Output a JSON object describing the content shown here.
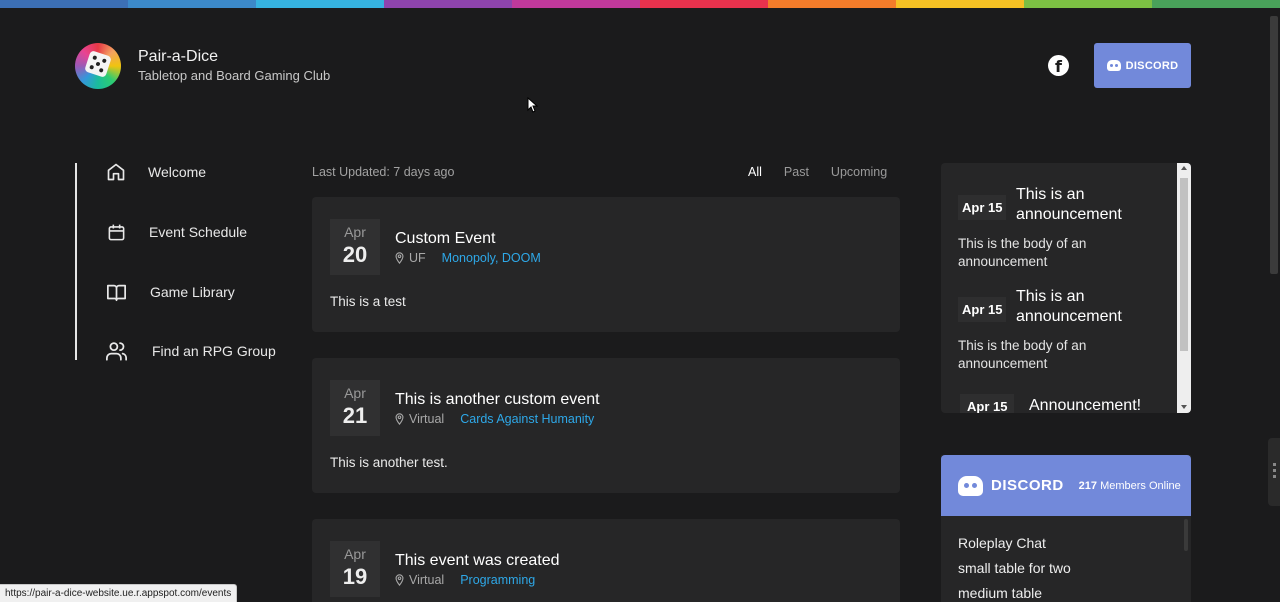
{
  "rainbow_colors": [
    "#3c6fb5",
    "#3c89c9",
    "#36b3e0",
    "#8e44ad",
    "#c0399b",
    "#e8324d",
    "#f47c2a",
    "#f6c124",
    "#7cc043",
    "#49a25a"
  ],
  "brand": {
    "title": "Pair-a-Dice",
    "subtitle": "Tabletop and Board Gaming Club"
  },
  "header": {
    "facebook_icon": "facebook-icon",
    "discord_label": "DISCORD"
  },
  "nav": [
    {
      "label": "Welcome",
      "icon": "home-icon"
    },
    {
      "label": "Event Schedule",
      "icon": "calendar-icon"
    },
    {
      "label": "Game Library",
      "icon": "book-icon"
    },
    {
      "label": "Find an RPG Group",
      "icon": "users-icon"
    }
  ],
  "events": {
    "last_updated": "Last Updated:  7 days ago",
    "filters": [
      "All",
      "Past",
      "Upcoming"
    ],
    "items": [
      {
        "month": "Apr",
        "day": "20",
        "title": "Custom Event",
        "location": "UF",
        "games": "Monopoly, DOOM",
        "body": "This is a test"
      },
      {
        "month": "Apr",
        "day": "21",
        "title": "This is another custom event",
        "location": "Virtual",
        "games": "Cards Against Humanity",
        "body": "This is another test."
      },
      {
        "month": "Apr",
        "day": "19",
        "title": "This event was created",
        "location": "Virtual",
        "games": "Programming",
        "body": ""
      }
    ]
  },
  "announcements": [
    {
      "date": "Apr 15",
      "title": "This is an announcement",
      "body": "This is the body of an announcement"
    },
    {
      "date": "Apr 15",
      "title": "This is an announcement",
      "body": "This is the body of an announcement"
    },
    {
      "date": "Apr 15",
      "title": "Announcement!",
      "body": ""
    }
  ],
  "discord_widget": {
    "word": "DISCORD",
    "members_count": "217",
    "members_label": "Members Online",
    "channels": [
      "Roleplay Chat",
      "small table for two",
      "medium table"
    ]
  },
  "status_url": "https://pair-a-dice-website.ue.r.appspot.com/events"
}
